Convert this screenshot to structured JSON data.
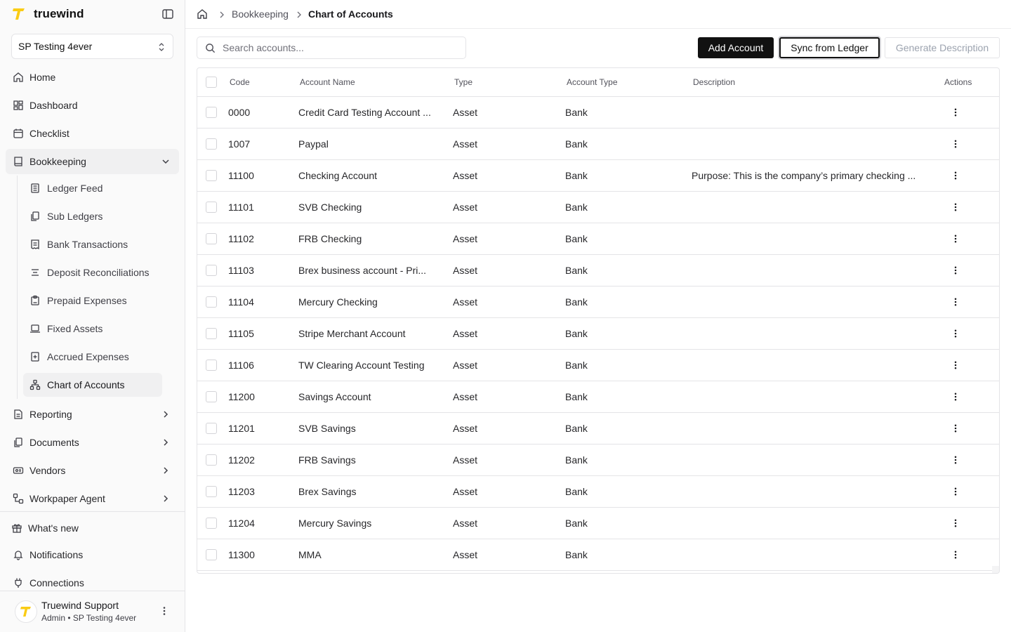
{
  "app": {
    "name": "truewind",
    "brand_color": "#facc15"
  },
  "sidebar": {
    "org": "SP Testing 4ever",
    "nav": [
      {
        "label": "Home",
        "icon": "home-icon"
      },
      {
        "label": "Dashboard",
        "icon": "dashboard-icon"
      },
      {
        "label": "Checklist",
        "icon": "calendar-check-icon"
      },
      {
        "label": "Bookkeeping",
        "icon": "book-icon"
      }
    ],
    "bookkeeping_sub": [
      {
        "label": "Ledger Feed",
        "icon": "ledger-icon"
      },
      {
        "label": "Sub Ledgers",
        "icon": "files-icon"
      },
      {
        "label": "Bank Transactions",
        "icon": "receipt-icon"
      },
      {
        "label": "Deposit Reconciliations",
        "icon": "reconcile-icon"
      },
      {
        "label": "Prepaid Expenses",
        "icon": "clipboard-icon"
      },
      {
        "label": "Fixed Assets",
        "icon": "laptop-icon"
      },
      {
        "label": "Accrued Expenses",
        "icon": "plus-square-icon"
      },
      {
        "label": "Chart of Accounts",
        "icon": "hierarchy-icon"
      }
    ],
    "more": [
      {
        "label": "Reporting",
        "icon": "report-icon"
      },
      {
        "label": "Documents",
        "icon": "documents-icon"
      },
      {
        "label": "Vendors",
        "icon": "vendors-icon"
      },
      {
        "label": "Workpaper Agent",
        "icon": "workflow-icon"
      }
    ],
    "bottom": [
      {
        "label": "What's new",
        "icon": "gift-icon"
      },
      {
        "label": "Notifications",
        "icon": "bell-icon"
      },
      {
        "label": "Connections",
        "icon": "plug-icon"
      }
    ],
    "user": {
      "name": "Truewind Support",
      "role": "Admin • SP Testing 4ever"
    }
  },
  "breadcrumb": {
    "section": "Bookkeeping",
    "current": "Chart of Accounts"
  },
  "toolbar": {
    "search_placeholder": "Search accounts...",
    "add_label": "Add Account",
    "sync_label": "Sync from Ledger",
    "generate_label": "Generate Description"
  },
  "table": {
    "columns": [
      "Code",
      "Account Name",
      "Type",
      "Account Type",
      "Description",
      "Actions"
    ],
    "rows": [
      {
        "code": "0000",
        "name": "Credit Card Testing Account ...",
        "type": "Asset",
        "account_type": "Bank",
        "description": ""
      },
      {
        "code": "1007",
        "name": "Paypal",
        "type": "Asset",
        "account_type": "Bank",
        "description": ""
      },
      {
        "code": "11100",
        "name": "Checking Account",
        "type": "Asset",
        "account_type": "Bank",
        "description": "Purpose: This is the company’s primary checking ..."
      },
      {
        "code": "11101",
        "name": "SVB Checking",
        "type": "Asset",
        "account_type": "Bank",
        "description": ""
      },
      {
        "code": "11102",
        "name": "FRB Checking",
        "type": "Asset",
        "account_type": "Bank",
        "description": ""
      },
      {
        "code": "11103",
        "name": "Brex business account - Pri...",
        "type": "Asset",
        "account_type": "Bank",
        "description": ""
      },
      {
        "code": "11104",
        "name": "Mercury Checking",
        "type": "Asset",
        "account_type": "Bank",
        "description": ""
      },
      {
        "code": "11105",
        "name": "Stripe Merchant Account",
        "type": "Asset",
        "account_type": "Bank",
        "description": ""
      },
      {
        "code": "11106",
        "name": "TW Clearing Account Testing",
        "type": "Asset",
        "account_type": "Bank",
        "description": ""
      },
      {
        "code": "11200",
        "name": "Savings Account",
        "type": "Asset",
        "account_type": "Bank",
        "description": ""
      },
      {
        "code": "11201",
        "name": "SVB Savings",
        "type": "Asset",
        "account_type": "Bank",
        "description": ""
      },
      {
        "code": "11202",
        "name": "FRB Savings",
        "type": "Asset",
        "account_type": "Bank",
        "description": ""
      },
      {
        "code": "11203",
        "name": "Brex Savings",
        "type": "Asset",
        "account_type": "Bank",
        "description": ""
      },
      {
        "code": "11204",
        "name": "Mercury Savings",
        "type": "Asset",
        "account_type": "Bank",
        "description": ""
      },
      {
        "code": "11300",
        "name": "MMA",
        "type": "Asset",
        "account_type": "Bank",
        "description": ""
      }
    ]
  }
}
